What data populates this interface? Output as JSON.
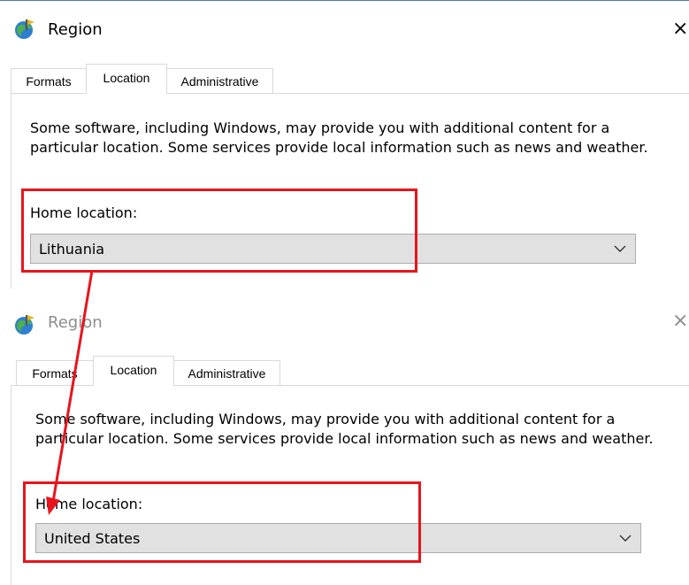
{
  "top_dialog": {
    "title": "Region",
    "close_glyph": "×",
    "tabs": [
      {
        "label": "Formats",
        "active": false
      },
      {
        "label": "Location",
        "active": true
      },
      {
        "label": "Administrative",
        "active": false
      }
    ],
    "description": "Some software, including Windows, may provide you with additional content for a particular location. Some services provide local information such as news and weather.",
    "home_location_label": "Home location:",
    "home_location_value": "Lithuania"
  },
  "bottom_dialog": {
    "title": "Region",
    "close_glyph": "×",
    "tabs": [
      {
        "label": "Formats",
        "active": false
      },
      {
        "label": "Location",
        "active": true
      },
      {
        "label": "Administrative",
        "active": false
      }
    ],
    "description": "Some software, including Windows, may provide you with additional content for a particular location. Some services provide local information such as news and weather.",
    "home_location_label": "Home location:",
    "home_location_value": "United States"
  },
  "icons": {
    "title_icon": "region-globe-icon",
    "dropdown_icon": "chevron-down-icon",
    "close_icon": "close-icon",
    "annotation_arrow": "arrow-icon"
  },
  "colors": {
    "highlight": "#e8141c",
    "combo_bg": "#e1e1e1",
    "tab_border": "#d9d9d9",
    "inactive_title": "#8d8d8d"
  }
}
